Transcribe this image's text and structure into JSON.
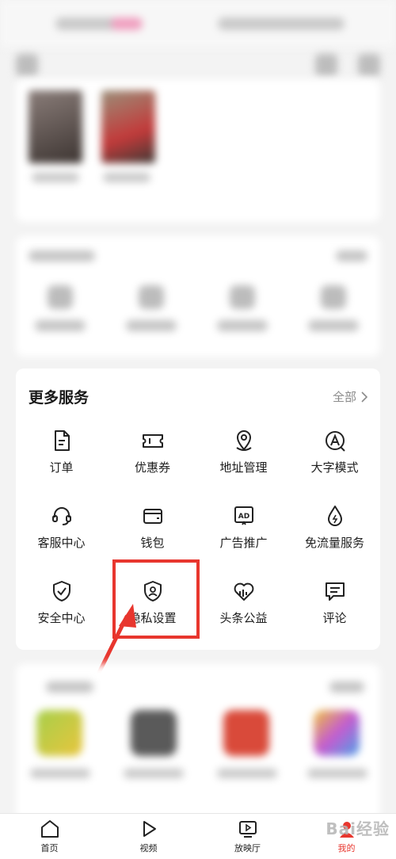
{
  "more_services": {
    "title": "更多服务",
    "all_label": "全部",
    "items": [
      {
        "label": "订单",
        "icon": "order-icon"
      },
      {
        "label": "优惠券",
        "icon": "coupon-icon"
      },
      {
        "label": "地址管理",
        "icon": "location-icon"
      },
      {
        "label": "大字模式",
        "icon": "large-font-icon"
      },
      {
        "label": "客服中心",
        "icon": "headset-icon"
      },
      {
        "label": "钱包",
        "icon": "wallet-icon"
      },
      {
        "label": "广告推广",
        "icon": "ad-icon"
      },
      {
        "label": "免流量服务",
        "icon": "data-drop-icon"
      },
      {
        "label": "安全中心",
        "icon": "shield-check-icon"
      },
      {
        "label": "隐私设置",
        "icon": "privacy-shield-icon"
      },
      {
        "label": "头条公益",
        "icon": "charity-heart-icon"
      },
      {
        "label": "评论",
        "icon": "comment-icon"
      }
    ]
  },
  "bottom_nav": {
    "tabs": [
      {
        "label": "首页",
        "icon": "home-icon"
      },
      {
        "label": "视频",
        "icon": "play-icon"
      },
      {
        "label": "放映厅",
        "icon": "tv-icon"
      },
      {
        "label": "我的",
        "icon": "profile-icon"
      }
    ]
  },
  "watermark": "Bai经验",
  "colors": {
    "accent": "#e8362e",
    "card": "#ffffff",
    "background": "#f3f3f3"
  }
}
